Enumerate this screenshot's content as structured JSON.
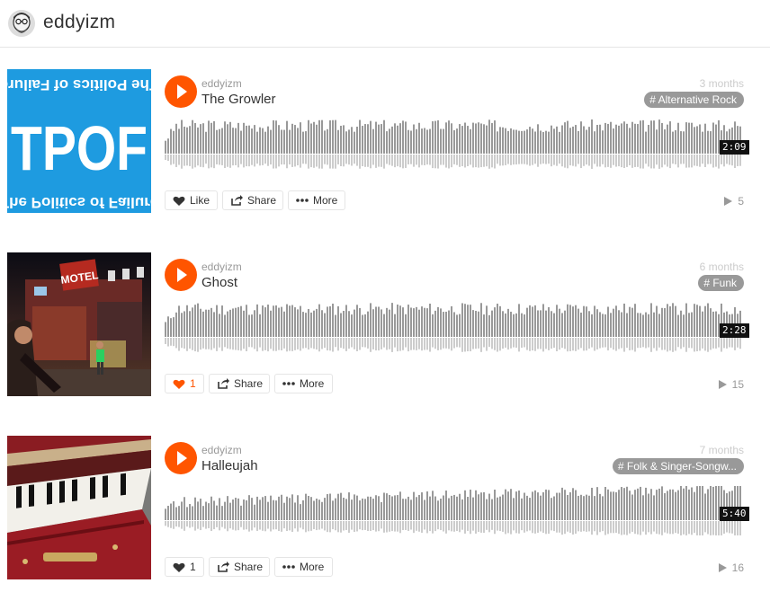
{
  "header": {
    "username": "eddyizm"
  },
  "tracks": [
    {
      "user": "eddyizm",
      "title": "The Growler",
      "posted": "3 months",
      "tag": "# Alternative Rock",
      "duration": "2:09",
      "like_label": "Like",
      "share_label": "Share",
      "more_label": "More",
      "plays": "5",
      "liked": false,
      "artwork": {
        "kind": "tpof",
        "text_big": "TPOF",
        "text_small": "The Politics of Failure",
        "bg": "#1e9be0"
      }
    },
    {
      "user": "eddyizm",
      "title": "Ghost",
      "posted": "6 months",
      "tag": "# Funk",
      "duration": "2:28",
      "like_label": "1",
      "share_label": "Share",
      "more_label": "More",
      "plays": "15",
      "liked": true,
      "artwork": {
        "kind": "photo-motel",
        "sign_text": "MOTEL"
      }
    },
    {
      "user": "eddyizm",
      "title": "Halleujah",
      "posted": "7 months",
      "tag": "# Folk & Singer-Songw...",
      "duration": "5:40",
      "like_label": "1",
      "share_label": "Share",
      "more_label": "More",
      "plays": "16",
      "liked": false,
      "artwork": {
        "kind": "photo-harmonium"
      }
    }
  ],
  "colors": {
    "accent": "#ff5500",
    "wave": "#999999",
    "wave_reflection": "#cccccc",
    "muted": "#999999"
  }
}
